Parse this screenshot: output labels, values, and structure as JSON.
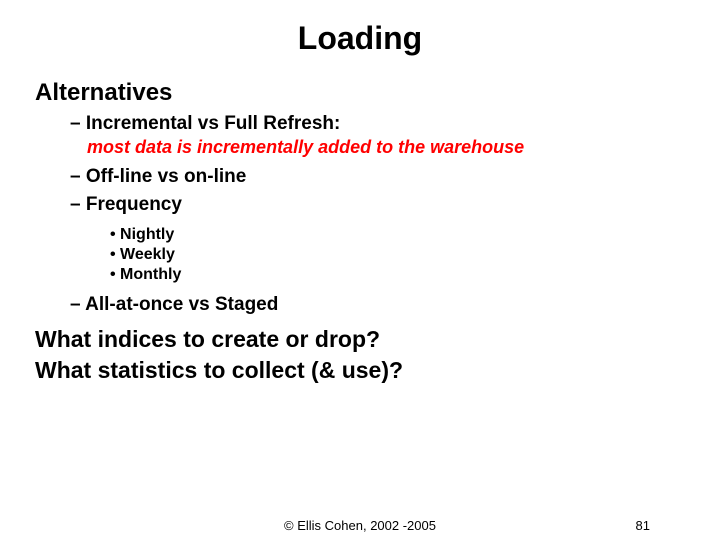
{
  "title": "Loading",
  "sectionHeading": "Alternatives",
  "items": {
    "d1": "– Incremental vs Full Refresh:",
    "note": "most data is incrementally added to the warehouse",
    "d2": "– Off-line vs on-line",
    "d3": "– Frequency",
    "b1": "• Nightly",
    "b2": "• Weekly",
    "b3": "• Monthly",
    "d4": "– All-at-once vs Staged"
  },
  "q1": "What indices to create or drop?",
  "q2": "What statistics to collect (& use)?",
  "footer": {
    "copyright": "© Ellis Cohen, 2002 -2005",
    "pageNumber": "81"
  }
}
